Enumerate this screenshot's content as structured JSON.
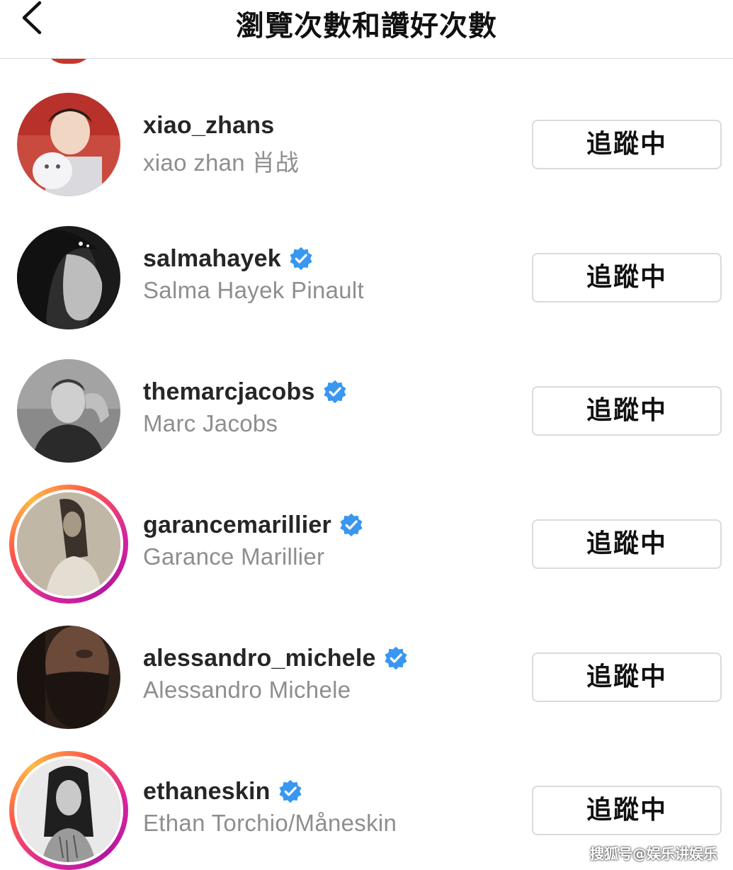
{
  "header": {
    "title": "瀏覽次數和讚好次數"
  },
  "colors": {
    "verified_blue": "#3897f0",
    "secondary_text": "#8e8e8e",
    "button_border": "#dbdbdb"
  },
  "users": [
    {
      "username": "xiao_zhans",
      "full_name": "xiao zhan 肖战",
      "verified": false,
      "story_ring": false,
      "button_label": "追蹤中"
    },
    {
      "username": "salmahayek",
      "full_name": "Salma Hayek Pinault",
      "verified": true,
      "story_ring": false,
      "button_label": "追蹤中"
    },
    {
      "username": "themarcjacobs",
      "full_name": "Marc Jacobs",
      "verified": true,
      "story_ring": false,
      "button_label": "追蹤中"
    },
    {
      "username": "garancemarillier",
      "full_name": "Garance Marillier",
      "verified": true,
      "story_ring": true,
      "button_label": "追蹤中"
    },
    {
      "username": "alessandro_michele",
      "full_name": "Alessandro Michele",
      "verified": true,
      "story_ring": false,
      "button_label": "追蹤中"
    },
    {
      "username": "ethaneskin",
      "full_name": "Ethan Torchio/Måneskin",
      "verified": true,
      "story_ring": true,
      "button_label": "追蹤中"
    }
  ],
  "watermark": "搜狐号@娱乐讲娱乐"
}
